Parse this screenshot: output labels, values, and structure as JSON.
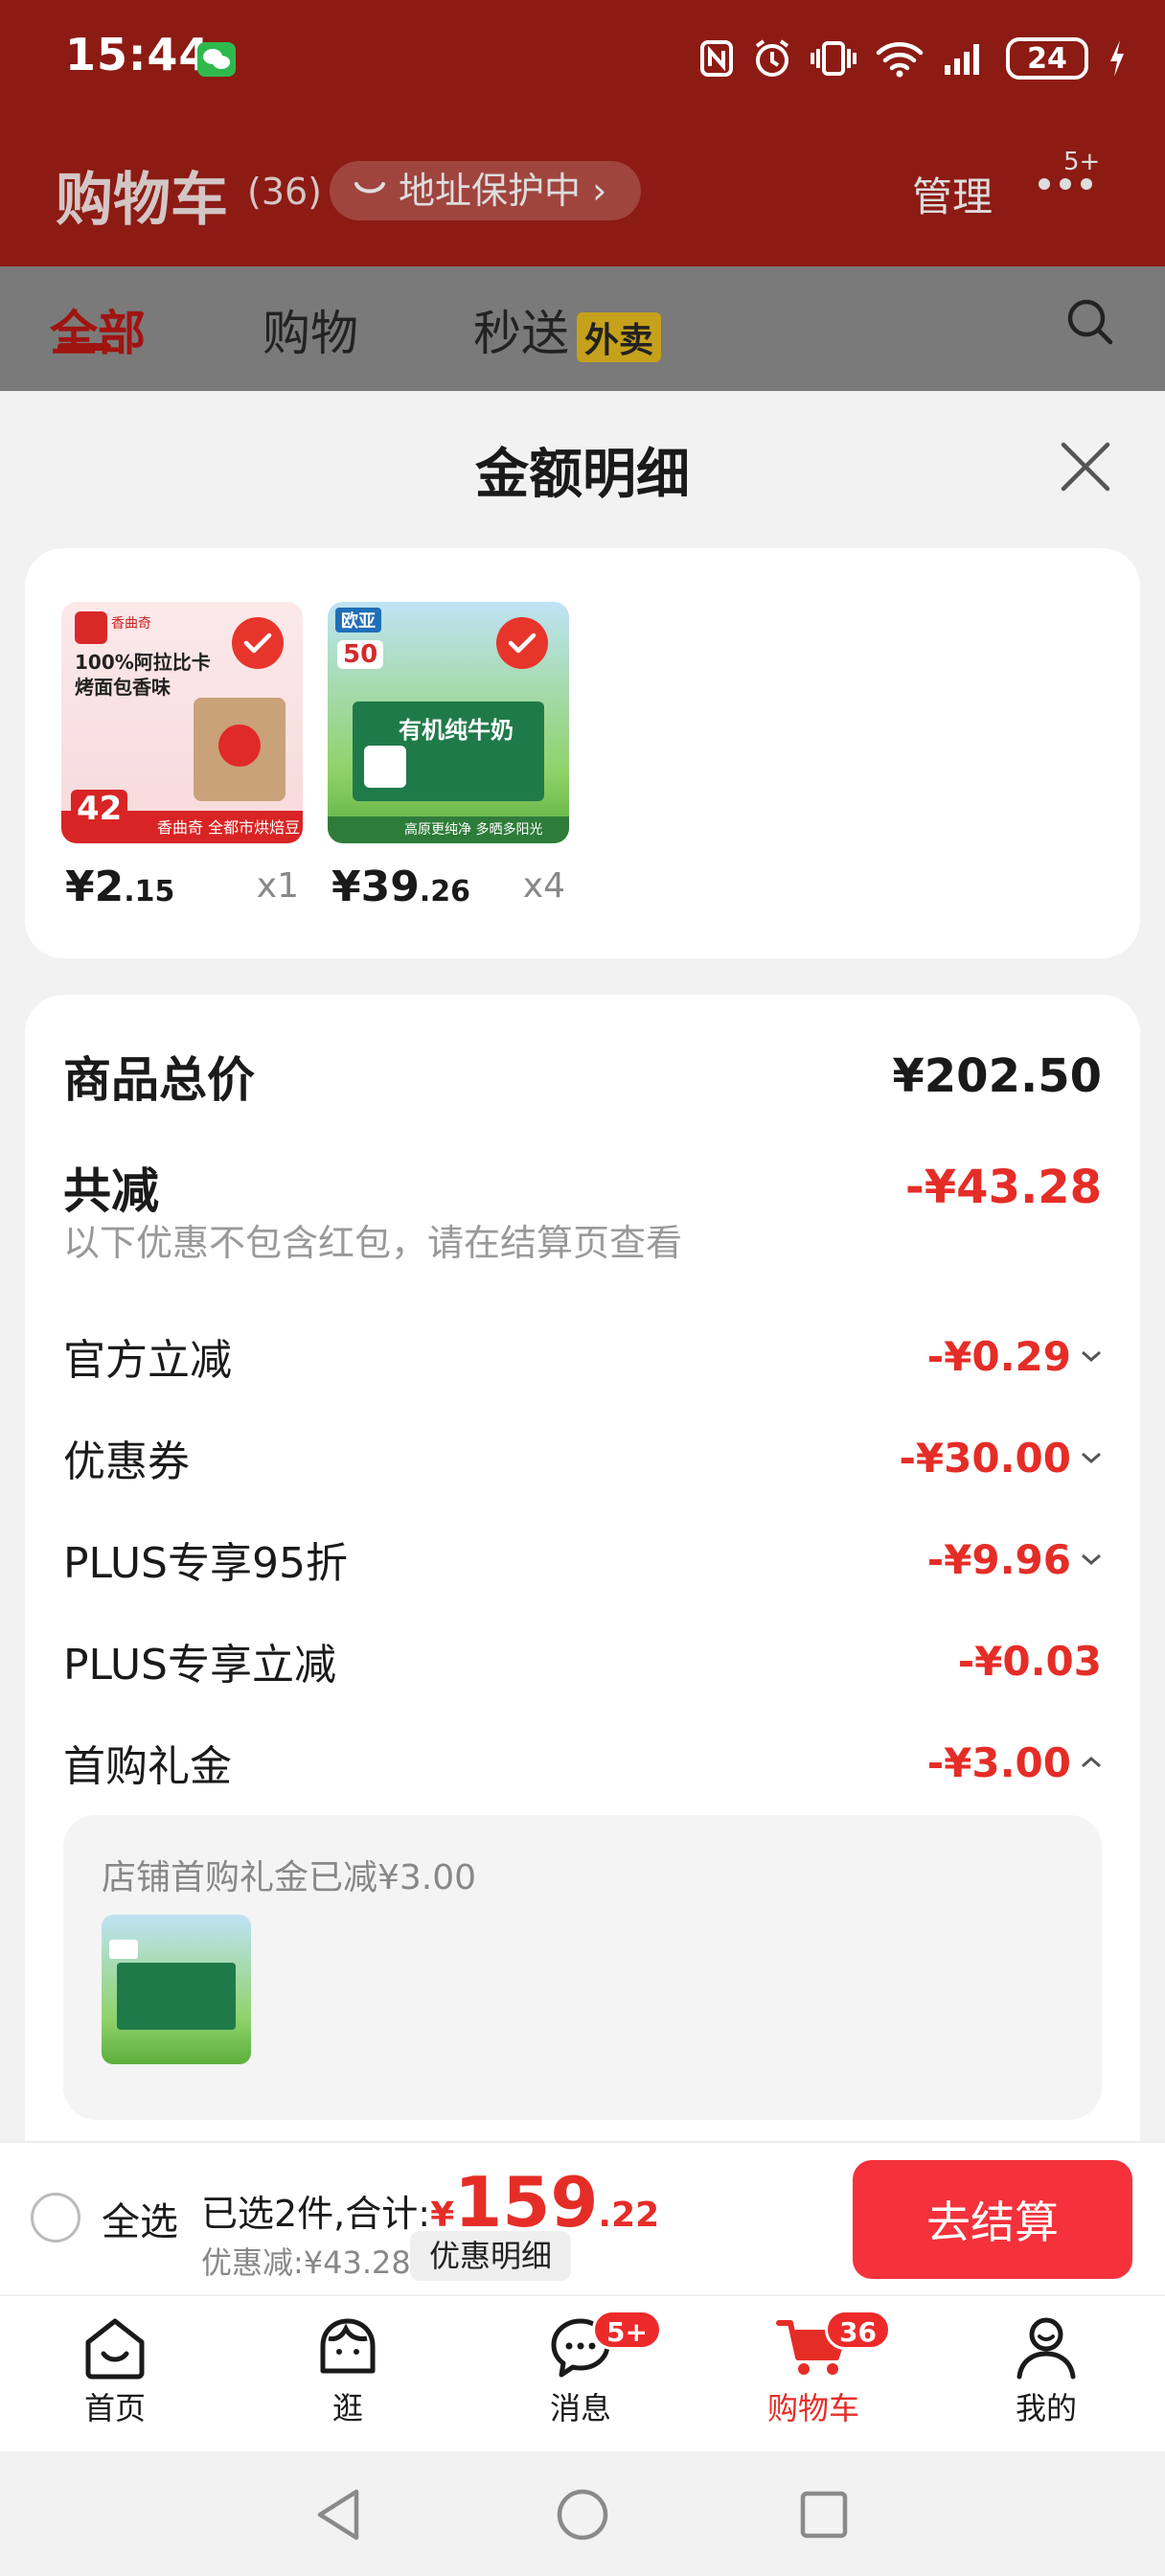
{
  "status_bar": {
    "time": "15:44",
    "battery": "24"
  },
  "cart_header": {
    "title": "购物车",
    "count": "(36)",
    "address_protect": "地址保护中",
    "manage": "管理",
    "more_badge": "5+"
  },
  "tabs": [
    {
      "label": "全部",
      "active": true
    },
    {
      "label": "购物",
      "active": false
    },
    {
      "label": "秒送",
      "badge": "外卖",
      "active": false
    }
  ],
  "sheet": {
    "title": "金额明细",
    "products": [
      {
        "price_int": "¥2",
        "price_dec": ".15",
        "qty": "x1",
        "image_caption": "100%阿拉比卡 烤面包香味",
        "image_brand": "香曲奇",
        "image_tag": "42",
        "image_footer": "香曲奇 全都市烘焙豆"
      },
      {
        "price_int": "¥39",
        "price_dec": ".26",
        "qty": "x4",
        "image_caption": "有机纯牛奶",
        "image_brand": "欧亚",
        "image_tag": "50",
        "image_footer": "高原更纯净 多晒多阳光"
      }
    ],
    "total_label": "商品总价",
    "total_value": "¥202.50",
    "discount_label": "共减",
    "discount_value": "-¥43.28",
    "discount_note": "以下优惠不包含红包，请在结算页查看",
    "items": [
      {
        "label": "官方立减",
        "value": "-¥0.29",
        "chevron": "down"
      },
      {
        "label": "优惠券",
        "value": "-¥30.00",
        "chevron": "down"
      },
      {
        "label": "PLUS专享95折",
        "value": "-¥9.96",
        "chevron": "down"
      },
      {
        "label": "PLUS专享立减",
        "value": "-¥0.03",
        "chevron": "none"
      },
      {
        "label": "首购礼金",
        "value": "-¥3.00",
        "chevron": "up"
      }
    ],
    "gift_note": "店铺首购礼金已减¥3.00"
  },
  "checkout": {
    "select_all": "全选",
    "selected_text": "已选2件,合计:",
    "currency": "¥",
    "amount_int": "159",
    "amount_dec": ".22",
    "saved_text": "优惠减:¥43.28",
    "detail_button": "优惠明细",
    "go_button": "去结算"
  },
  "bottom_nav": [
    {
      "label": "首页",
      "icon": "home-icon"
    },
    {
      "label": "逛",
      "icon": "stroll-icon"
    },
    {
      "label": "消息",
      "icon": "message-icon",
      "badge": "5+"
    },
    {
      "label": "购物车",
      "icon": "cart-icon",
      "badge": "36",
      "active": true
    },
    {
      "label": "我的",
      "icon": "profile-icon"
    }
  ],
  "colors": {
    "accent": "#e52d27",
    "header_dim": "#8c1b14",
    "checkout_button": "#f5313b"
  }
}
